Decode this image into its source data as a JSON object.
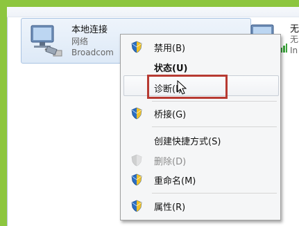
{
  "adapter": {
    "name": "本地连接",
    "network": "网络",
    "device": "Broadcom"
  },
  "adapter2": {
    "name": "无",
    "line2": "无",
    "line3": "In"
  },
  "context_menu": {
    "items": [
      {
        "label": "禁用(B)",
        "icon": "uac-shield-icon"
      },
      {
        "label": "状态(U)",
        "bold": true
      },
      {
        "label": "诊断(I)"
      },
      {
        "label": "桥接(G)",
        "icon": "uac-shield-icon"
      },
      {
        "label": "创建快捷方式(S)"
      },
      {
        "label": "删除(D)",
        "disabled": true,
        "icon": "uac-shield-icon"
      },
      {
        "label": "重命名(M)",
        "icon": "uac-shield-icon"
      },
      {
        "label": "属性(R)",
        "icon": "uac-shield-icon"
      }
    ]
  },
  "colors": {
    "frame": "#8dc63f",
    "highlight_box": "#b73a32",
    "menu_bg": "#f5f6f7"
  }
}
